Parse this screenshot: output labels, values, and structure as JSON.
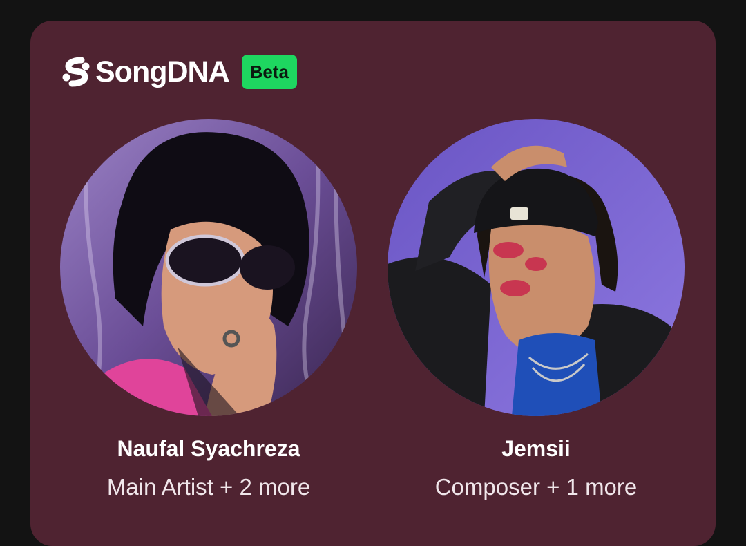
{
  "header": {
    "brand": "SongDNA",
    "badge": "Beta",
    "logo_icon": "songdna-logo-icon"
  },
  "credits": [
    {
      "name": "Naufal Syachreza",
      "role": "Main Artist + 2 more"
    },
    {
      "name": "Jemsii",
      "role": "Composer + 1 more"
    }
  ],
  "colors": {
    "card": "#4f2331",
    "background": "#131313",
    "badge": "#1ed760"
  }
}
